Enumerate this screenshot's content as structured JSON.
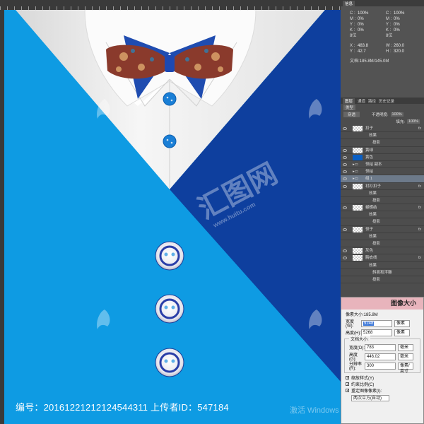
{
  "canvas": {
    "colors": {
      "left_blue": "#0e9be3",
      "dark_blue": "#0e3f9e",
      "shirt_white": "#f4f4f4",
      "background": "#0e9be3"
    },
    "layer_buttons_count_note": "",
    "watermark": {
      "main": "汇图网",
      "url": "www.huitu.com"
    }
  },
  "footer": {
    "label": "编号：20161221212124544311 上传者ID：547184"
  },
  "windows_watermark": "激活 Windows",
  "info_panel": {
    "tab": "信息",
    "rows": [
      {
        "k1": "C :",
        "v1": "100%",
        "k2": "C :",
        "v2": "100%"
      },
      {
        "k1": "M :",
        "v1": "0%",
        "k2": "M :",
        "v2": "0%"
      },
      {
        "k1": "Y :",
        "v1": "0%",
        "k2": "Y :",
        "v2": "0%"
      },
      {
        "k1": "K :",
        "v1": "0%",
        "k2": "K :",
        "v2": "0%"
      },
      {
        "k1": "8位",
        "v1": "",
        "k2": "8位",
        "v2": ""
      }
    ],
    "coords": [
      {
        "k1": "X :",
        "v1": "483.8",
        "k2": "W :",
        "v2": "260.0"
      },
      {
        "k1": "Y :",
        "v1": "42.7",
        "k2": "H :",
        "v2": "320.0"
      }
    ],
    "doc": "文档:185.8M/145.0M"
  },
  "layers_panel": {
    "tabs": [
      "图层",
      "通道",
      "路径",
      "历史记录"
    ],
    "filter_label": "类型",
    "blend": "穿透",
    "opacity_label": "不透明度:",
    "opacity": "100%",
    "fill_label": "填充:",
    "fill": "100%",
    "layers": [
      {
        "name": "扣子",
        "type": "layer",
        "fx": true
      },
      {
        "name": "效果",
        "type": "sub"
      },
      {
        "name": "投影",
        "type": "sub2"
      },
      {
        "name": "黄绿",
        "type": "layer"
      },
      {
        "name": "黄色",
        "type": "layer",
        "thumb": "blue"
      },
      {
        "name": "领结 副本",
        "type": "group"
      },
      {
        "name": "领结",
        "type": "group"
      },
      {
        "name": "组 1",
        "type": "group",
        "selected": true
      },
      {
        "name": "衬衫扣子",
        "type": "layer",
        "fx": true
      },
      {
        "name": "效果",
        "type": "sub"
      },
      {
        "name": "投影",
        "type": "sub2"
      },
      {
        "name": "蝴蝶结",
        "type": "layer",
        "fx": true
      },
      {
        "name": "效果",
        "type": "sub"
      },
      {
        "name": "投影",
        "type": "sub2"
      },
      {
        "name": "领子",
        "type": "layer",
        "fx": true
      },
      {
        "name": "效果",
        "type": "sub"
      },
      {
        "name": "投影",
        "type": "sub2"
      },
      {
        "name": "灰色",
        "type": "layer"
      },
      {
        "name": "胸衣线",
        "type": "layer",
        "fx": true
      },
      {
        "name": "效果",
        "type": "sub"
      },
      {
        "name": "斜面和浮雕",
        "type": "sub2"
      },
      {
        "name": "投影",
        "type": "sub2"
      }
    ]
  },
  "image_size_dialog": {
    "title": "图像大小",
    "pixel_size": "像素大小:185.8M",
    "width_label": "宽度(W):",
    "width_value": "9248",
    "width_unit": "像素",
    "height_label": "高度(H):",
    "height_value": "5268",
    "height_unit": "像素",
    "doc_size": "文档大小:",
    "doc_width_label": "宽度(D):",
    "doc_width_value": "783",
    "doc_width_unit": "毫米",
    "doc_height_label": "高度(G):",
    "doc_height_value": "446.02",
    "doc_height_unit": "毫米",
    "res_label": "分辨率(R):",
    "res_value": "300",
    "res_unit": "像素/英寸",
    "checks": [
      "缩放样式(Y)",
      "约束比例(C)",
      "重定图像像素(I):"
    ],
    "resample": "两次立方(自动)"
  }
}
